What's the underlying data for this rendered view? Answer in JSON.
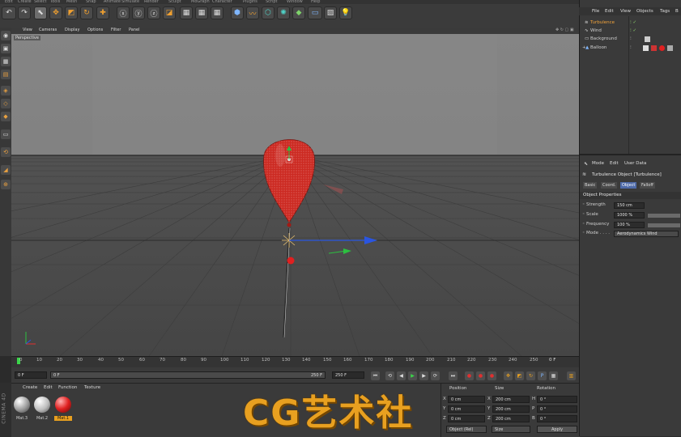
{
  "menubar": [
    "Edit",
    "Create",
    "Select",
    "Tools",
    "Mesh",
    "Snap",
    "Animate",
    "Simulate",
    "Render",
    "Sculpt",
    "MoGraph",
    "Character",
    "Plugins",
    "Script",
    "Window",
    "Help"
  ],
  "viewport": {
    "menu": [
      "View",
      "Cameras",
      "Display",
      "Options",
      "Filter",
      "Panel"
    ],
    "label": "Perspective"
  },
  "timeline": {
    "ticks": [
      "0",
      "10",
      "20",
      "30",
      "40",
      "50",
      "60",
      "70",
      "80",
      "90",
      "100",
      "110",
      "120",
      "130",
      "140",
      "150",
      "160",
      "170",
      "180",
      "190",
      "200",
      "210",
      "220",
      "230",
      "240",
      "250"
    ],
    "frame_end_label": "0 F",
    "current_frame": "0 F",
    "range_start": "0 F",
    "range_end": "250 F",
    "max_frame": "250 F"
  },
  "materials": {
    "menu": [
      "Create",
      "Edit",
      "Function",
      "Texture"
    ],
    "items": [
      {
        "name": "Mat.3",
        "color": "#d8d8d8"
      },
      {
        "name": "Mat.2",
        "color": "#e6e6e6"
      },
      {
        "name": "Mat.1",
        "color": "#e02020"
      }
    ],
    "watermark": "CG艺术社",
    "brand": "CINEMA 4D"
  },
  "coordinates": {
    "headers": [
      "Position",
      "Size",
      "Rotation"
    ],
    "rows": [
      {
        "axis": "X",
        "pos": "0 cm",
        "size": "200 cm",
        "rot_axis": "H",
        "rot": "0 °"
      },
      {
        "axis": "Y",
        "pos": "0 cm",
        "size": "200 cm",
        "rot_axis": "P",
        "rot": "0 °"
      },
      {
        "axis": "Z",
        "pos": "0 cm",
        "size": "200 cm",
        "rot_axis": "B",
        "rot": "0 °"
      }
    ],
    "mode_select": "Object (Rel)",
    "size_select": "Size",
    "apply_label": "Apply"
  },
  "objects": {
    "menu": [
      "File",
      "Edit",
      "View",
      "Objects",
      "Tags",
      "B"
    ],
    "items": [
      {
        "name": "Turbulence",
        "active": true
      },
      {
        "name": "Wind",
        "active": false
      },
      {
        "name": "Background",
        "active": false
      },
      {
        "name": "Balloon",
        "active": false
      }
    ]
  },
  "attributes": {
    "menu": [
      "Mode",
      "Edit",
      "User Data"
    ],
    "object_title": "Turbulence Object [Turbulence]",
    "tabs": [
      "Basic",
      "Coord.",
      "Object",
      "Falloff"
    ],
    "active_tab": "Object",
    "section": "Object Properties",
    "props": [
      {
        "label": "Strength",
        "value": "150 cm",
        "slider": false
      },
      {
        "label": "Scale",
        "value": "1000 %",
        "slider": true
      },
      {
        "label": "Frequency",
        "value": "100 %",
        "slider": true
      },
      {
        "label": "Mode . . . .",
        "value": "Aerodynamics Wind",
        "slider": false
      }
    ]
  },
  "colors": {
    "balloon": "#cc2a22",
    "axis_x": "#2a55e0",
    "axis_y": "#2cc040",
    "accent_orange": "#e8a020",
    "active_object": "#f2a33a"
  }
}
